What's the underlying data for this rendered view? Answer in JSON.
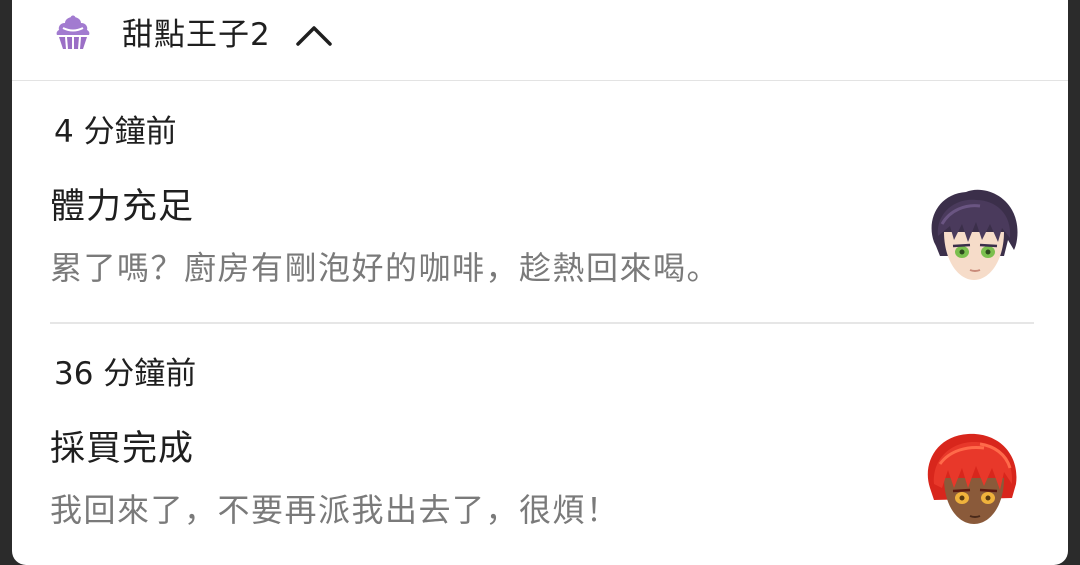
{
  "app": {
    "name": "甜點王子2",
    "icon": "cupcake-icon",
    "accent": "#9b6fc6"
  },
  "notifications": [
    {
      "time": "4 分鐘前",
      "title": "體力充足",
      "body": "累了嗎？廚房有剛泡好的咖啡，趁熱回來喝。",
      "avatar": "dark-haired-character-avatar"
    },
    {
      "time": "36 分鐘前",
      "title": "採買完成",
      "body": "我回來了，不要再派我出去了，很煩！",
      "avatar": "red-haired-character-avatar"
    }
  ]
}
